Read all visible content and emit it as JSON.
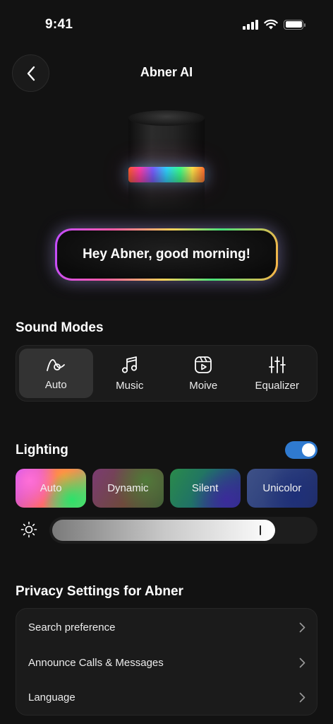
{
  "status_bar": {
    "time": "9:41"
  },
  "header": {
    "title": "Abner AI"
  },
  "greeting": {
    "text": "Hey Abner, good morning!"
  },
  "sound_modes": {
    "heading": "Sound Modes",
    "selected": "Auto",
    "items": [
      {
        "label": "Auto",
        "icon": "auto-curve-icon"
      },
      {
        "label": "Music",
        "icon": "music-note-icon"
      },
      {
        "label": "Moive",
        "icon": "movie-play-icon"
      },
      {
        "label": "Equalizer",
        "icon": "equalizer-sliders-icon"
      }
    ]
  },
  "lighting": {
    "heading": "Lighting",
    "enabled": true,
    "modes": [
      {
        "label": "Auto"
      },
      {
        "label": "Dynamic"
      },
      {
        "label": "Silent"
      },
      {
        "label": "Unicolor"
      }
    ],
    "brightness_fraction": 0.85,
    "accent_color": "#2f7ad0"
  },
  "privacy": {
    "heading": "Privacy Settings for Abner",
    "items": [
      {
        "label": "Search preference"
      },
      {
        "label": "Announce Calls & Messages"
      },
      {
        "label": "Language"
      }
    ]
  }
}
